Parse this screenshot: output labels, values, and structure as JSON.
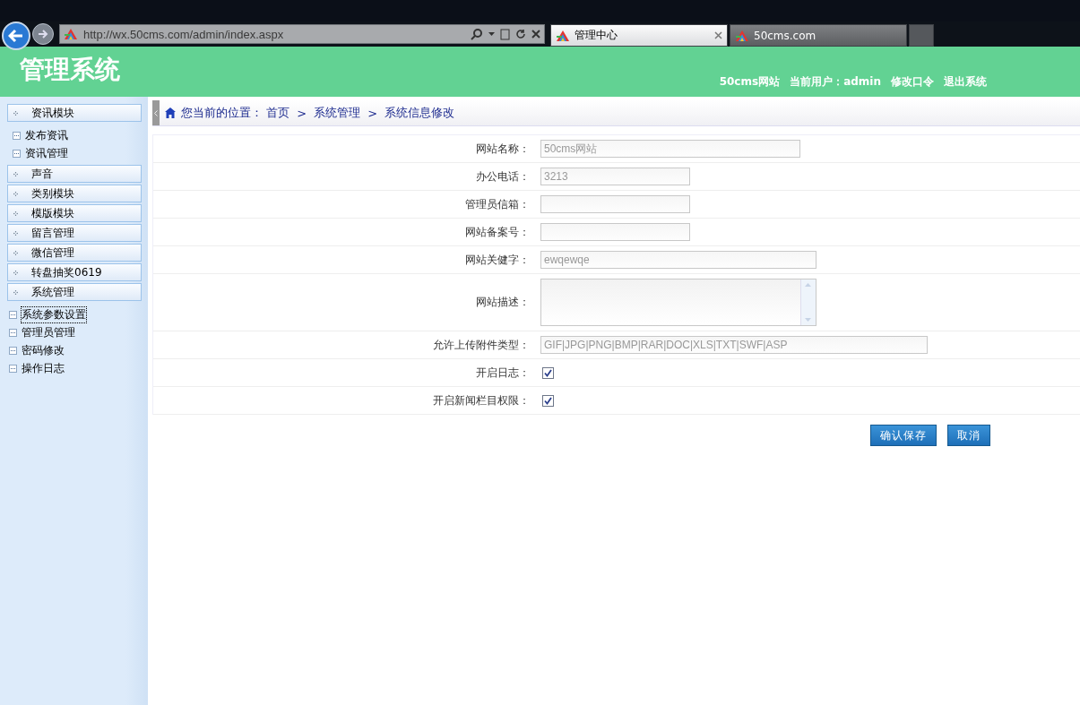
{
  "browser": {
    "url": "http://wx.50cms.com/admin/index.aspx",
    "tabs": [
      {
        "label": "管理中心",
        "selected": true
      },
      {
        "label": "50cms.com",
        "selected": false
      }
    ]
  },
  "header": {
    "title": "管理系统",
    "links": [
      "50cms网站",
      "当前用户：admin",
      "修改口令",
      "退出系统"
    ]
  },
  "sidebar": {
    "groups": [
      {
        "label": "资讯模块",
        "children": [
          {
            "label": "发布资讯",
            "selected": false
          },
          {
            "label": "资讯管理",
            "selected": false
          }
        ]
      },
      {
        "label": "声音"
      },
      {
        "label": "类别模块"
      },
      {
        "label": "模版模块"
      },
      {
        "label": "留言管理"
      },
      {
        "label": "微信管理"
      },
      {
        "label": "转盘抽奖0619"
      },
      {
        "label": "系统管理",
        "children": [
          {
            "label": "系统参数设置",
            "selected": true
          },
          {
            "label": "管理员管理",
            "selected": false
          },
          {
            "label": "密码修改",
            "selected": false
          },
          {
            "label": "操作日志",
            "selected": false
          }
        ]
      }
    ]
  },
  "breadcrumb": {
    "prefix": "您当前的位置：",
    "items": [
      "首页",
      "系统管理",
      "系统信息修改"
    ],
    "separator": ">"
  },
  "form": {
    "fields": [
      {
        "label": "网站名称：",
        "kind": "text",
        "value": "50cms网站"
      },
      {
        "label": "办公电话：",
        "kind": "text",
        "value": "3213"
      },
      {
        "label": "管理员信箱：",
        "kind": "text"
      },
      {
        "label": "网站备案号：",
        "kind": "text"
      },
      {
        "label": "网站关健字：",
        "kind": "text",
        "value": "ewqewqe"
      },
      {
        "label": "网站描述：",
        "kind": "textarea"
      },
      {
        "label": "允许上传附件类型：",
        "kind": "text",
        "value": "GIF|JPG|PNG|BMP|RAR|DOC|XLS|TXT|SWF|ASP"
      },
      {
        "label": "开启日志：",
        "kind": "checkbox",
        "checked": true
      },
      {
        "label": "开启新闻栏目权限：",
        "kind": "checkbox",
        "checked": true
      }
    ],
    "buttons": [
      "确认保存",
      "取消"
    ]
  }
}
